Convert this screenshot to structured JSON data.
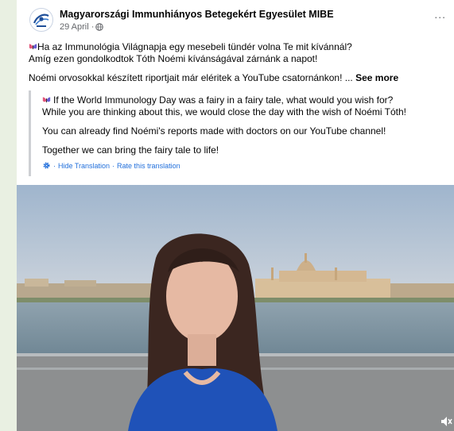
{
  "post": {
    "page_name": "Magyarországi Immunhiányos Betegekért Egyesület MIBE",
    "date": "29 April ·",
    "more_label": "...",
    "original_line1": "Ha az Immunológia Világnapja egy mesebeli tündér volna Te mit kívánnál?",
    "original_line2": "Amíg ezen gondolkodtok Tóth Noémi kívánságával zárnánk a napot!",
    "original_line3": "Noémi orvosokkal készített riportjait már eléritek a YouTube csatornánkon! ...",
    "see_more": "See more",
    "translation": {
      "line1": "If the World Immunology Day was a fairy in a fairy tale, what would you wish for?",
      "line2": "While you are thinking about this, we would close the day with the wish of Noémi Tóth!",
      "line3": "You can already find Noémi's reports made with doctors on our YouTube channel!",
      "line4": "Together we can bring the fairy tale to life!",
      "hide_label": "Hide Translation",
      "separator": "·",
      "rate_label": "Rate this translation"
    }
  },
  "icons": {
    "avatar": "mibe-logo-icon",
    "privacy": "globe-icon",
    "emoji": "butterfly-icon",
    "settings": "gear-icon",
    "volume": "speaker-icon"
  },
  "colors": {
    "page_bg": "#e9f0e2",
    "link": "#216fdb",
    "meta": "#65676b",
    "river": "#7d96a6",
    "sky": "#b9c8d8"
  }
}
